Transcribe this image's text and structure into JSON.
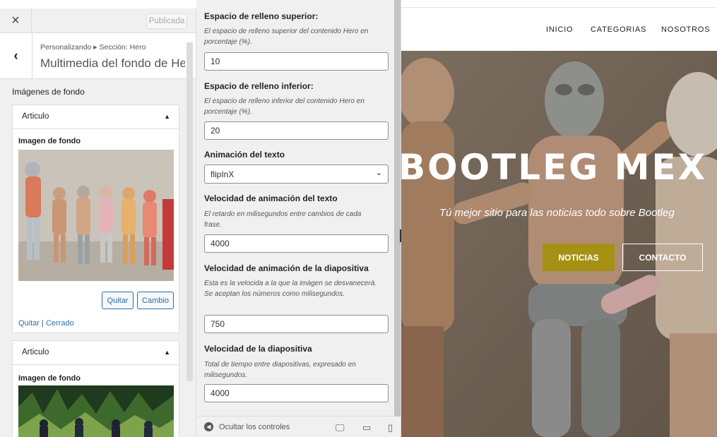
{
  "customizer": {
    "close_icon": "×",
    "publish_label": "Publicada",
    "breadcrumb": "Personalizando ▸ Sección: Hero",
    "section_title": "Multimedia del fondo de He...",
    "group_label": "Imágenes de fondo",
    "cards": [
      {
        "title": "Articulo",
        "field_label": "Imagen de fondo",
        "remove_label": "Quitar",
        "change_label": "Cambio",
        "link_remove": "Quitar",
        "link_close": "Cerrado"
      },
      {
        "title": "Articulo",
        "field_label": "Imagen de fondo"
      }
    ]
  },
  "controls": {
    "top_padding": {
      "title": "Espacio de relleno superior:",
      "desc": "El espacio de relleno superior del contenido Hero en porcentaje (%).",
      "value": "10"
    },
    "bottom_padding": {
      "title": "Espacio de relleno inferior:",
      "desc": "El espacio de relleno inferior del contenido Hero en porcentaje (%).",
      "value": "20"
    },
    "text_animation": {
      "title": "Animación del texto",
      "value": "flipInX"
    },
    "text_speed": {
      "title": "Velocidad de animación del texto",
      "desc": "El retardo en milisegundos entre cambios de cada frase.",
      "value": "4000"
    },
    "slide_anim_speed": {
      "title": "Velocidad de animación de la diapositiva",
      "desc": "Esta es la velocida a la que la imágen se desvanecerá. Se aceptan los números como milisegundos.",
      "value": "750"
    },
    "slide_speed": {
      "title": "Velocidad de la diapositiva",
      "desc": "Total de tiempo entre diapositivas, expresado en milisegundos.",
      "value": "4000"
    },
    "footer": {
      "hide_label": "Ocultar los controles"
    }
  },
  "preview": {
    "nav": [
      "INICIO",
      "CATEGORIAS",
      "NOSOTROS"
    ],
    "hero_title": "BOOTLEG MEX",
    "hero_subtitle": "Tú mejor sitio para las noticias todo sobre Bootleg",
    "btn_news": "NOTICIAS",
    "btn_contact": "CONTACTO",
    "accent_color": "#a59114"
  }
}
